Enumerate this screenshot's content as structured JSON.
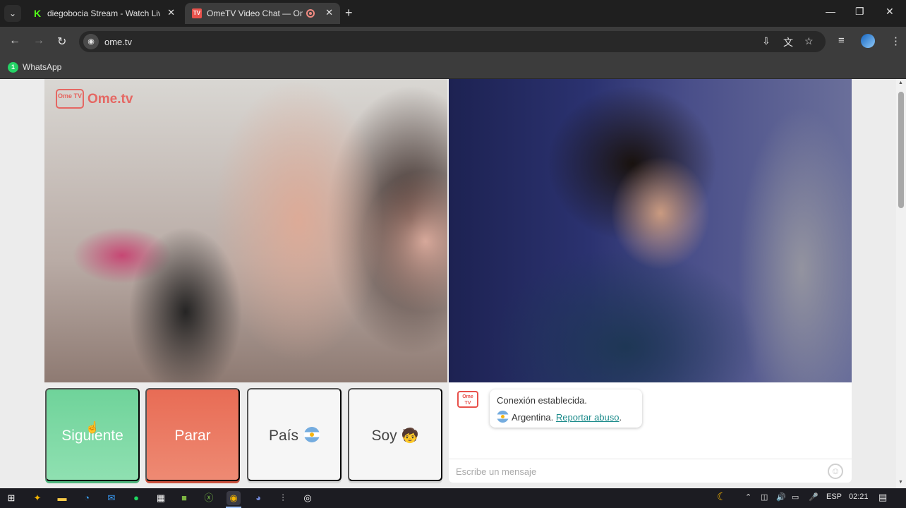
{
  "browser": {
    "tabs": [
      {
        "title": "diegobocia Stream - Watch Live",
        "favicon": "kick-k-icon"
      },
      {
        "title": "OmeTV Video Chat — OmeTV",
        "favicon": "ometv-icon",
        "recording": true
      }
    ],
    "url": "ome.tv",
    "bookmarks": [
      {
        "label": "WhatsApp",
        "badge": "1"
      }
    ]
  },
  "page": {
    "logo_small": "Ome TV",
    "logo_word": "Ome.tv",
    "buttons": {
      "next": "Siguiente",
      "stop": "Parar",
      "country": "País",
      "gender": "Soy",
      "gender_emoji": "🧒"
    },
    "chat": {
      "logo": "Ome TV",
      "status": "Conexión establecida.",
      "country": "Argentina.",
      "report": "Reportar abuso",
      "report_suffix": ".",
      "placeholder": "Escribe un mensaje"
    }
  },
  "taskbar": {
    "language": "ESP",
    "time": "02:21"
  },
  "colors": {
    "next": "#6fd39a",
    "stop": "#e86c55",
    "brand": "#e8514b",
    "link": "#1a8a8a"
  }
}
